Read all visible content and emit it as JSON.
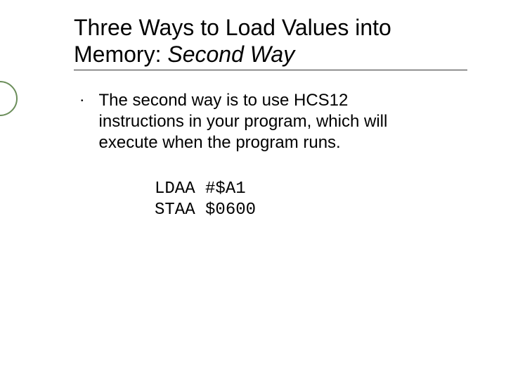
{
  "slide": {
    "title": {
      "line1": "Three Ways to Load Values into",
      "line2_plain": "Memory: ",
      "line2_italic": "Second Way"
    },
    "bullet": {
      "marker": "•",
      "text": "The second way is to use HCS12 instructions in your program, which will execute when the program runs."
    },
    "code": {
      "line1": "LDAA #$A1",
      "line2": "STAA $0600"
    }
  }
}
